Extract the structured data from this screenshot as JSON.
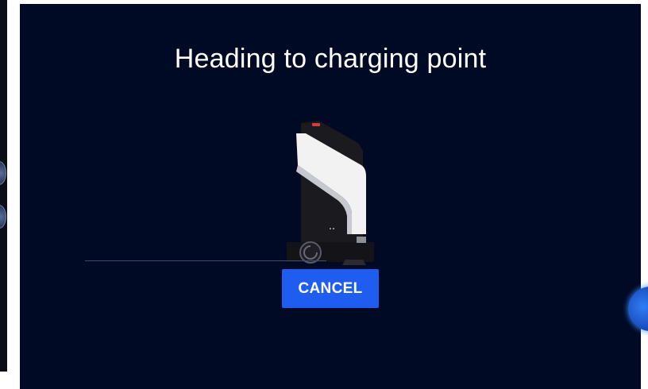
{
  "screen": {
    "title": "Heading to charging point",
    "cancel_label": "CANCEL"
  },
  "colors": {
    "background": "#010a24",
    "button": "#1f5df1",
    "text": "#ffffff"
  },
  "icons": {
    "robot": "robot-illustration-icon",
    "side_controls": "side-knob-icon",
    "edge_button": "floating-orb-icon"
  }
}
